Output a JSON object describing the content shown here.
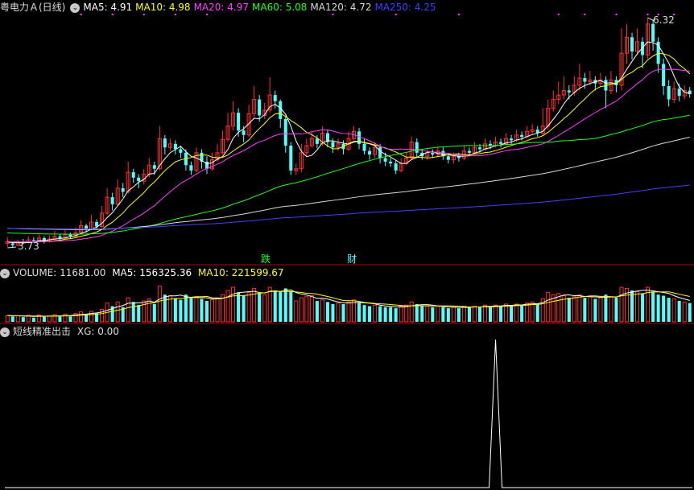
{
  "stock": {
    "title": "粤电力Ａ(日线)",
    "ma": [
      {
        "label": "MA5: 4.91",
        "color": "#ffffff"
      },
      {
        "label": "MA10: 4.98",
        "color": "#ffff00"
      },
      {
        "label": "MA20: 4.97",
        "color": "#ff40ff"
      },
      {
        "label": "MA60: 5.08",
        "color": "#20ff20"
      },
      {
        "label": "MA120: 4.72",
        "color": "#d8d8d8"
      },
      {
        "label": "MA250: 4.25",
        "color": "#4040ff"
      }
    ],
    "high_label": "6.32",
    "low_label": "3.73",
    "marker_die": "跌",
    "marker_cai": "财"
  },
  "volume": {
    "label": "VOLUME: 11681.00",
    "ma5": "MA5: 156325.36",
    "ma10": "MA10: 221599.67"
  },
  "indicator": {
    "name": "短线精准出击",
    "xg": "XG: 0.00"
  },
  "colors": {
    "up": "#ff3232",
    "down": "#54ffff",
    "ma5": "#ffffff",
    "ma10": "#ffff00",
    "ma20": "#ff40ff",
    "ma60": "#20ff20",
    "ma120": "#d8d8d8",
    "ma250": "#4040ff",
    "separator": "#b00000",
    "signal_dot": "#ff40ff"
  },
  "chart_data": {
    "type": "candlestick",
    "price_range": [
      3.73,
      6.32
    ],
    "candles": [
      [
        3.8,
        3.78,
        3.85,
        3.74,
        "u"
      ],
      [
        3.78,
        3.76,
        3.8,
        3.73,
        "d"
      ],
      [
        3.76,
        3.8,
        3.82,
        3.75,
        "u"
      ],
      [
        3.8,
        3.79,
        3.83,
        3.77,
        "d"
      ],
      [
        3.79,
        3.82,
        3.86,
        3.78,
        "u"
      ],
      [
        3.82,
        3.81,
        3.85,
        3.79,
        "d"
      ],
      [
        3.81,
        3.84,
        3.88,
        3.8,
        "u"
      ],
      [
        3.84,
        3.8,
        3.86,
        3.78,
        "d"
      ],
      [
        3.8,
        3.83,
        3.87,
        3.79,
        "u"
      ],
      [
        3.83,
        3.86,
        3.92,
        3.82,
        "u"
      ],
      [
        3.86,
        3.84,
        3.88,
        3.81,
        "d"
      ],
      [
        3.84,
        3.88,
        3.93,
        3.83,
        "u"
      ],
      [
        3.88,
        3.86,
        3.9,
        3.83,
        "d"
      ],
      [
        3.86,
        3.9,
        3.96,
        3.85,
        "u"
      ],
      [
        3.9,
        3.98,
        4.04,
        3.89,
        "u"
      ],
      [
        3.98,
        3.94,
        4.0,
        3.9,
        "d"
      ],
      [
        3.94,
        4.02,
        4.1,
        3.93,
        "u"
      ],
      [
        4.02,
        3.97,
        4.05,
        3.94,
        "d"
      ],
      [
        3.97,
        4.12,
        4.2,
        3.96,
        "u"
      ],
      [
        4.12,
        4.3,
        4.4,
        4.1,
        "u"
      ],
      [
        4.3,
        4.22,
        4.35,
        4.15,
        "d"
      ],
      [
        4.22,
        4.4,
        4.5,
        4.2,
        "u"
      ],
      [
        4.4,
        4.36,
        4.46,
        4.3,
        "d"
      ],
      [
        4.36,
        4.58,
        4.7,
        4.34,
        "u"
      ],
      [
        4.58,
        4.52,
        4.62,
        4.46,
        "d"
      ],
      [
        4.52,
        4.48,
        4.56,
        4.4,
        "d"
      ],
      [
        4.48,
        4.56,
        4.62,
        4.44,
        "u"
      ],
      [
        4.56,
        4.66,
        4.74,
        4.52,
        "u"
      ],
      [
        4.66,
        4.62,
        4.7,
        4.55,
        "d"
      ],
      [
        4.62,
        4.96,
        5.1,
        4.6,
        "u"
      ],
      [
        4.96,
        4.86,
        5.0,
        4.78,
        "d"
      ],
      [
        4.86,
        4.9,
        4.96,
        4.82,
        "u"
      ],
      [
        4.9,
        4.84,
        4.94,
        4.78,
        "d"
      ],
      [
        4.84,
        4.8,
        4.88,
        4.74,
        "d"
      ],
      [
        4.8,
        4.66,
        4.84,
        4.6,
        "d"
      ],
      [
        4.66,
        4.6,
        4.7,
        4.55,
        "d"
      ],
      [
        4.6,
        4.8,
        4.86,
        4.58,
        "u"
      ],
      [
        4.8,
        4.7,
        4.84,
        4.62,
        "d"
      ],
      [
        4.7,
        4.62,
        4.76,
        4.56,
        "d"
      ],
      [
        4.62,
        4.72,
        4.8,
        4.6,
        "u"
      ],
      [
        4.72,
        4.8,
        4.9,
        4.7,
        "u"
      ],
      [
        4.8,
        4.95,
        5.05,
        4.78,
        "u"
      ],
      [
        4.95,
        5.1,
        5.25,
        4.92,
        "u"
      ],
      [
        5.1,
        5.25,
        5.38,
        5.05,
        "u"
      ],
      [
        5.25,
        5.05,
        5.3,
        4.98,
        "d"
      ],
      [
        5.05,
        5.0,
        5.1,
        4.92,
        "d"
      ],
      [
        5.0,
        5.24,
        5.34,
        4.98,
        "u"
      ],
      [
        5.24,
        5.4,
        5.55,
        5.2,
        "u"
      ],
      [
        5.4,
        5.22,
        5.45,
        5.15,
        "d"
      ],
      [
        5.22,
        5.28,
        5.36,
        5.18,
        "u"
      ],
      [
        5.28,
        5.45,
        5.65,
        5.25,
        "u"
      ],
      [
        5.45,
        5.38,
        5.5,
        5.3,
        "d"
      ],
      [
        5.38,
        5.18,
        5.4,
        5.08,
        "d"
      ],
      [
        5.18,
        4.88,
        5.22,
        4.8,
        "d"
      ],
      [
        4.88,
        4.6,
        4.92,
        4.55,
        "d"
      ],
      [
        4.6,
        4.62,
        4.68,
        4.55,
        "u"
      ],
      [
        4.62,
        4.8,
        4.9,
        4.58,
        "u"
      ],
      [
        4.8,
        4.88,
        4.96,
        4.76,
        "u"
      ],
      [
        4.88,
        4.96,
        5.04,
        4.86,
        "u"
      ],
      [
        4.96,
        4.9,
        5.0,
        4.85,
        "d"
      ],
      [
        4.9,
        5.02,
        5.1,
        4.88,
        "u"
      ],
      [
        5.02,
        4.92,
        5.06,
        4.86,
        "d"
      ],
      [
        4.92,
        4.86,
        4.96,
        4.8,
        "d"
      ],
      [
        4.86,
        4.9,
        4.96,
        4.82,
        "u"
      ],
      [
        4.9,
        4.84,
        4.94,
        4.78,
        "d"
      ],
      [
        4.84,
        4.96,
        5.04,
        4.82,
        "u"
      ],
      [
        4.96,
        5.04,
        5.1,
        4.94,
        "u"
      ],
      [
        5.04,
        4.9,
        5.08,
        4.84,
        "d"
      ],
      [
        4.9,
        4.82,
        4.96,
        4.78,
        "d"
      ],
      [
        4.82,
        4.78,
        4.86,
        4.72,
        "d"
      ],
      [
        4.78,
        4.86,
        4.92,
        4.74,
        "u"
      ],
      [
        4.86,
        4.74,
        4.9,
        4.68,
        "d"
      ],
      [
        4.74,
        4.7,
        4.8,
        4.65,
        "d"
      ],
      [
        4.7,
        4.68,
        4.74,
        4.64,
        "d"
      ],
      [
        4.68,
        4.6,
        4.72,
        4.56,
        "d"
      ],
      [
        4.6,
        4.68,
        4.74,
        4.58,
        "u"
      ],
      [
        4.68,
        4.74,
        4.8,
        4.66,
        "u"
      ],
      [
        4.74,
        4.92,
        4.98,
        4.72,
        "u"
      ],
      [
        4.92,
        4.8,
        4.96,
        4.74,
        "d"
      ],
      [
        4.8,
        4.76,
        4.84,
        4.72,
        "d"
      ],
      [
        4.76,
        4.8,
        4.84,
        4.72,
        "u"
      ],
      [
        4.8,
        4.78,
        4.84,
        4.74,
        "d"
      ],
      [
        4.78,
        4.82,
        4.86,
        4.75,
        "u"
      ],
      [
        4.82,
        4.76,
        4.86,
        4.72,
        "d"
      ],
      [
        4.76,
        4.72,
        4.8,
        4.68,
        "d"
      ],
      [
        4.72,
        4.76,
        4.8,
        4.68,
        "u"
      ],
      [
        4.76,
        4.74,
        4.8,
        4.7,
        "d"
      ],
      [
        4.74,
        4.82,
        4.88,
        4.72,
        "u"
      ],
      [
        4.82,
        4.8,
        4.86,
        4.76,
        "d"
      ],
      [
        4.8,
        4.86,
        4.92,
        4.78,
        "u"
      ],
      [
        4.86,
        4.84,
        4.9,
        4.8,
        "d"
      ],
      [
        4.84,
        4.9,
        4.96,
        4.82,
        "u"
      ],
      [
        4.9,
        4.88,
        4.94,
        4.84,
        "d"
      ],
      [
        4.88,
        4.92,
        4.98,
        4.86,
        "u"
      ],
      [
        4.92,
        4.9,
        4.96,
        4.86,
        "d"
      ],
      [
        4.9,
        4.96,
        5.02,
        4.88,
        "u"
      ],
      [
        4.96,
        4.94,
        5.0,
        4.9,
        "d"
      ],
      [
        4.94,
        5.0,
        5.06,
        4.92,
        "u"
      ],
      [
        5.0,
        4.98,
        5.04,
        4.94,
        "d"
      ],
      [
        4.98,
        5.04,
        5.1,
        4.96,
        "u"
      ],
      [
        5.04,
        5.06,
        5.12,
        5.0,
        "u"
      ],
      [
        5.06,
        5.02,
        5.1,
        4.98,
        "d"
      ],
      [
        5.02,
        5.1,
        5.3,
        5.0,
        "u"
      ],
      [
        5.1,
        5.3,
        5.4,
        5.06,
        "u"
      ],
      [
        5.3,
        5.4,
        5.5,
        5.26,
        "u"
      ],
      [
        5.4,
        5.45,
        5.6,
        5.35,
        "u"
      ],
      [
        5.45,
        5.5,
        5.66,
        5.4,
        "u"
      ],
      [
        5.5,
        5.48,
        5.56,
        5.4,
        "d"
      ],
      [
        5.48,
        5.56,
        5.66,
        5.44,
        "u"
      ],
      [
        5.56,
        5.64,
        5.8,
        5.5,
        "u"
      ],
      [
        5.64,
        5.6,
        5.7,
        5.52,
        "d"
      ],
      [
        5.6,
        5.62,
        5.72,
        5.56,
        "u"
      ],
      [
        5.62,
        5.58,
        5.66,
        5.5,
        "d"
      ],
      [
        5.58,
        5.62,
        5.7,
        5.54,
        "u"
      ],
      [
        5.62,
        5.5,
        5.66,
        5.3,
        "d"
      ],
      [
        5.5,
        5.62,
        5.72,
        5.46,
        "u"
      ],
      [
        5.62,
        5.56,
        5.66,
        5.48,
        "d"
      ],
      [
        5.56,
        5.92,
        6.2,
        5.5,
        "u"
      ],
      [
        5.92,
        6.1,
        6.25,
        5.8,
        "u"
      ],
      [
        6.1,
        5.94,
        6.15,
        5.85,
        "d"
      ],
      [
        5.94,
        6.05,
        6.2,
        5.9,
        "u"
      ],
      [
        6.05,
        5.9,
        6.1,
        5.75,
        "d"
      ],
      [
        5.9,
        6.25,
        6.32,
        5.86,
        "u"
      ],
      [
        6.25,
        6.05,
        6.3,
        5.95,
        "d"
      ],
      [
        6.05,
        5.8,
        6.1,
        5.7,
        "d"
      ],
      [
        5.8,
        5.55,
        5.86,
        5.45,
        "d"
      ],
      [
        5.55,
        5.4,
        5.62,
        5.32,
        "d"
      ],
      [
        5.4,
        5.52,
        5.6,
        5.36,
        "u"
      ],
      [
        5.52,
        5.44,
        5.58,
        5.38,
        "d"
      ],
      [
        5.44,
        5.5,
        5.56,
        5.4,
        "u"
      ],
      [
        5.5,
        5.46,
        5.54,
        5.42,
        "d"
      ]
    ],
    "volume_scale_max": 400000,
    "volumes": [
      60000,
      52000,
      58000,
      45000,
      62000,
      40000,
      66000,
      48000,
      56000,
      70000,
      50000,
      74000,
      52000,
      80000,
      95000,
      70000,
      100000,
      82000,
      120000,
      180000,
      150000,
      190000,
      140000,
      230000,
      190000,
      160000,
      200000,
      220000,
      170000,
      340000,
      260000,
      250000,
      220000,
      210000,
      260000,
      230000,
      240000,
      220000,
      200000,
      210000,
      230000,
      260000,
      300000,
      330000,
      280000,
      250000,
      280000,
      320000,
      270000,
      260000,
      330000,
      300000,
      290000,
      320000,
      290000,
      200000,
      230000,
      240000,
      250000,
      200000,
      210000,
      190000,
      170000,
      180000,
      170000,
      190000,
      210000,
      180000,
      160000,
      150000,
      160000,
      150000,
      140000,
      140000,
      130000,
      150000,
      160000,
      190000,
      170000,
      150000,
      150000,
      140000,
      150000,
      140000,
      130000,
      140000,
      130000,
      150000,
      140000,
      150000,
      140000,
      160000,
      150000,
      160000,
      150000,
      170000,
      160000,
      170000,
      160000,
      180000,
      190000,
      170000,
      220000,
      280000,
      260000,
      270000,
      250000,
      230000,
      240000,
      260000,
      230000,
      240000,
      220000,
      230000,
      260000,
      240000,
      230000,
      330000,
      320000,
      300000,
      290000,
      270000,
      330000,
      290000,
      260000,
      250000,
      230000,
      220000,
      200000,
      190000,
      180000,
      170000,
      160000
    ],
    "xg_signal_index": 93
  }
}
